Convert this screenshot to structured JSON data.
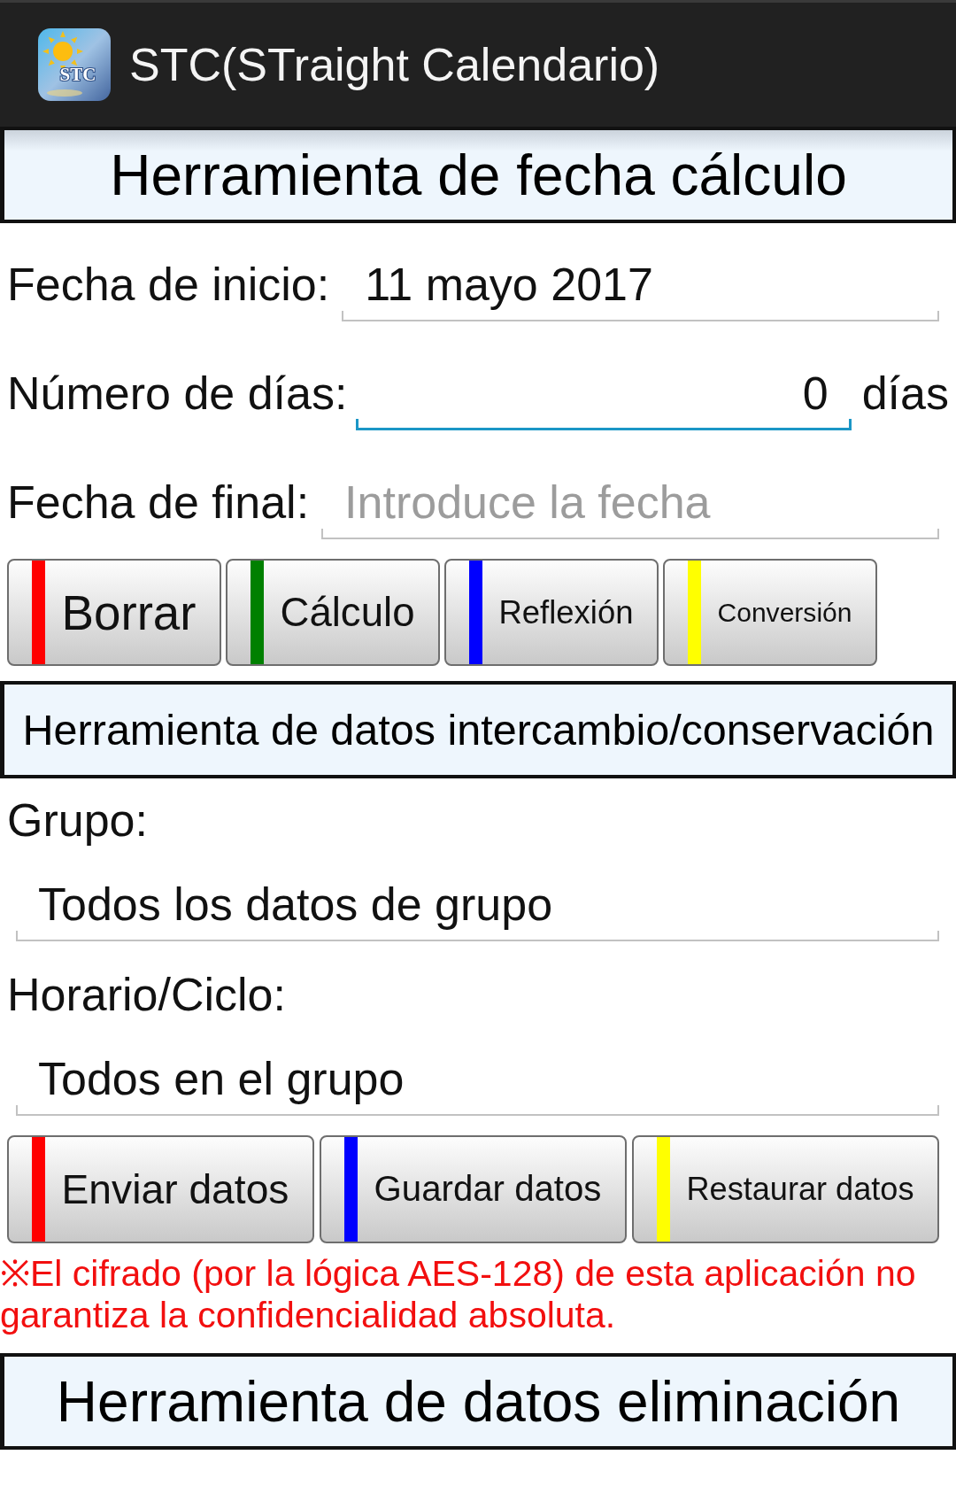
{
  "title_bar": {
    "logo_text": "STC",
    "title": "STC(STraight Calendario)"
  },
  "date_calculation": {
    "title": "Herramienta de fecha cálculo",
    "fields": [
      {
        "kind": "date",
        "label": "Fecha de inicio:",
        "value": "11 mayo 2017",
        "focused": false
      },
      {
        "kind": "number",
        "label": "Número de días:",
        "value": "0",
        "unit": "días",
        "focused": true
      },
      {
        "kind": "date",
        "label": "Fecha de final:",
        "placeholder": "Introduce la fecha",
        "focused": false
      }
    ],
    "buttons": [
      {
        "label": "Borrar",
        "color": "#ff0000"
      },
      {
        "label": "Cálculo",
        "color": "#008000"
      },
      {
        "label": "Reflexión",
        "color": "#0000ff"
      },
      {
        "label": "Conversión",
        "color": "#ffff00"
      }
    ]
  },
  "data_exchange": {
    "title": "Herramienta de datos intercambio/conservación",
    "selects": [
      {
        "label": "Grupo:",
        "value": "Todos los datos de grupo"
      },
      {
        "label": "Horario/Ciclo:",
        "value": "Todos en el grupo"
      }
    ],
    "buttons": [
      {
        "label": "Enviar datos",
        "color": "#ff0000"
      },
      {
        "label": "Guardar datos",
        "color": "#0000ff"
      },
      {
        "label": "Restaurar datos",
        "color": "#ffff00"
      }
    ],
    "note": "※El cifrado (por la lógica AES-128) de esta aplicación no garantiza la confidencialidad absoluta."
  },
  "data_deletion": {
    "title": "Herramienta de datos eliminación"
  }
}
